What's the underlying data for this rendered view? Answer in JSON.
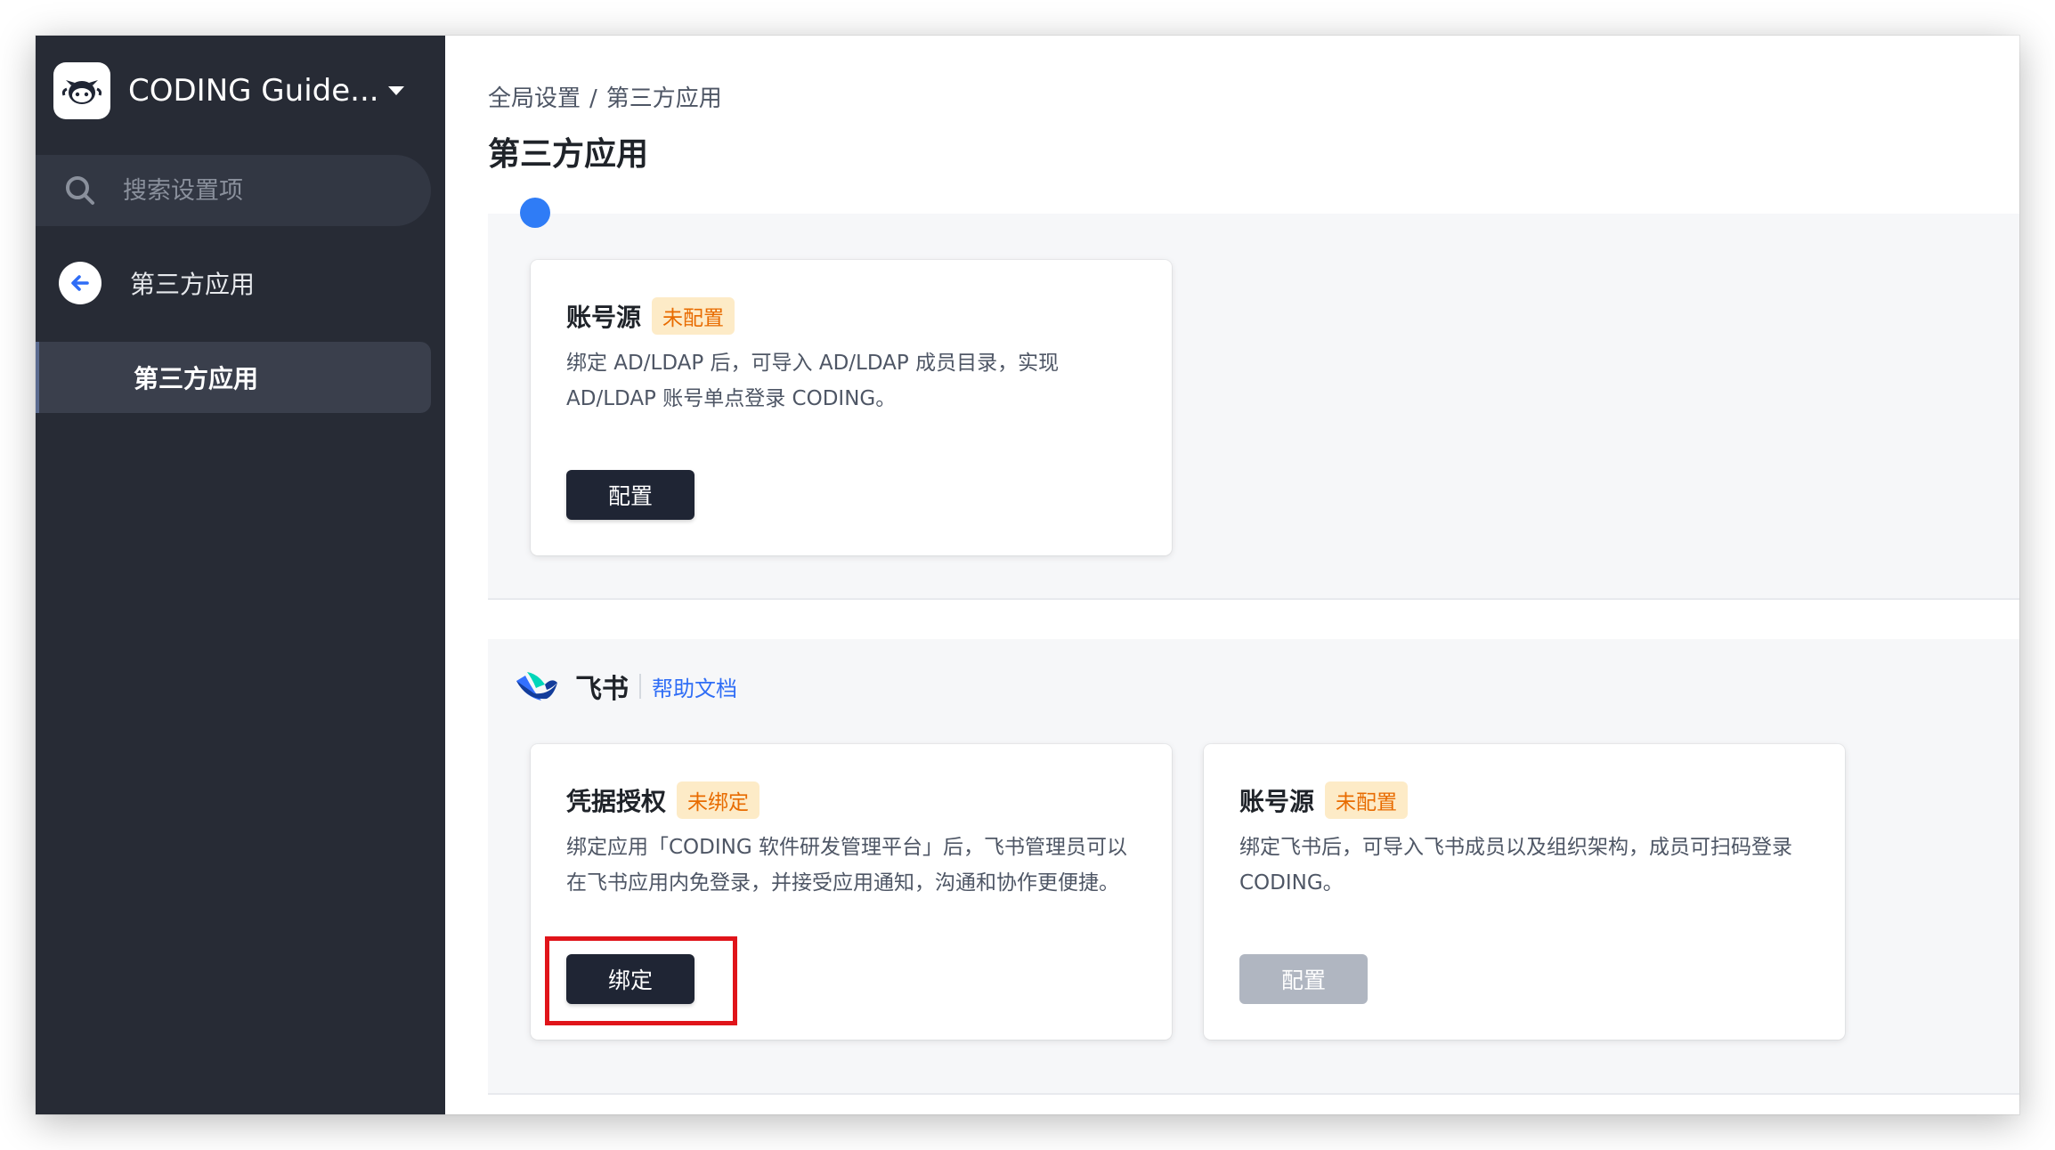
{
  "sidebar": {
    "org_name": "CODING Guide...",
    "search_placeholder": "搜索设置项",
    "back_label": "第三方应用",
    "active_item": "第三方应用"
  },
  "main": {
    "breadcrumb": [
      "全局设置",
      "第三方应用"
    ],
    "breadcrumb_sep": "/",
    "title": "第三方应用",
    "ldap_card": {
      "title": "账号源",
      "badge": "未配置",
      "description": "绑定 AD/LDAP 后，可导入 AD/LDAP 成员目录，实现 AD/LDAP 账号单点登录 CODING。",
      "button": "配置"
    },
    "feishu": {
      "name": "飞书",
      "help_link": "帮助文档",
      "credential_card": {
        "title": "凭据授权",
        "badge": "未绑定",
        "description": "绑定应用「CODING 软件研发管理平台」后，飞书管理员可以在飞书应用内免登录，并接受应用通知，沟通和协作更便捷。",
        "button": "绑定"
      },
      "account_card": {
        "title": "账号源",
        "badge": "未配置",
        "description": "绑定飞书后，可导入飞书成员以及组织架构，成员可扫码登录 CODING。",
        "button": "配置"
      }
    }
  },
  "colors": {
    "sidebar_bg": "#272b35",
    "badge_bg": "#fdebc7",
    "badge_text": "#e86b00",
    "link": "#2f6df6",
    "primary_button": "#1f2534",
    "disabled_button": "#b0b6c1",
    "highlight": "#e0141a"
  }
}
